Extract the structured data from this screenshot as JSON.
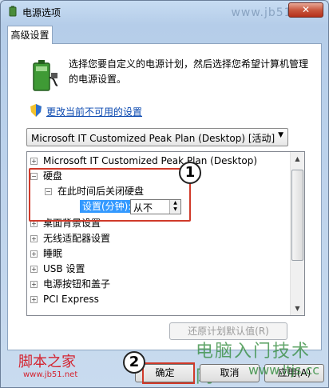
{
  "window": {
    "title": "电源选项",
    "close_label": "✕",
    "watermark": "www.jb51.net"
  },
  "tab": {
    "label": "高级设置"
  },
  "description": "选择您要自定义的电源计划，然后选择您希望计算机管理的电源设置。",
  "link": "更改当前不可用的设置",
  "plan_select": {
    "selected": "Microsoft IT Customized Peak Plan (Desktop) [活动]"
  },
  "tree": {
    "root": "Microsoft IT Customized Peak Plan (Desktop)",
    "hard_disk": "硬盘",
    "turn_off_disk": "在此时间后关闭硬盘",
    "setting_label": "设置(分钟):",
    "setting_value": "从不",
    "items": [
      "桌面背景设置",
      "无线适配器设置",
      "睡眠",
      "USB 设置",
      "电源按钮和盖子",
      "PCI Express"
    ]
  },
  "annotations": {
    "callout_1": "1",
    "callout_2": "2"
  },
  "buttons": {
    "restore_defaults": "还原计划默认值(R)",
    "ok": "确定",
    "cancel": "取消",
    "apply": "应用(A)"
  },
  "watermarks": {
    "left": "脚本之家",
    "left_url": "www.jb51.net",
    "right": "电脑入门技术网",
    "right_url": "www.ltjs.cc"
  },
  "colors": {
    "highlight": "#d03a2a",
    "selection": "#3399ff",
    "link": "#0b49b0"
  }
}
